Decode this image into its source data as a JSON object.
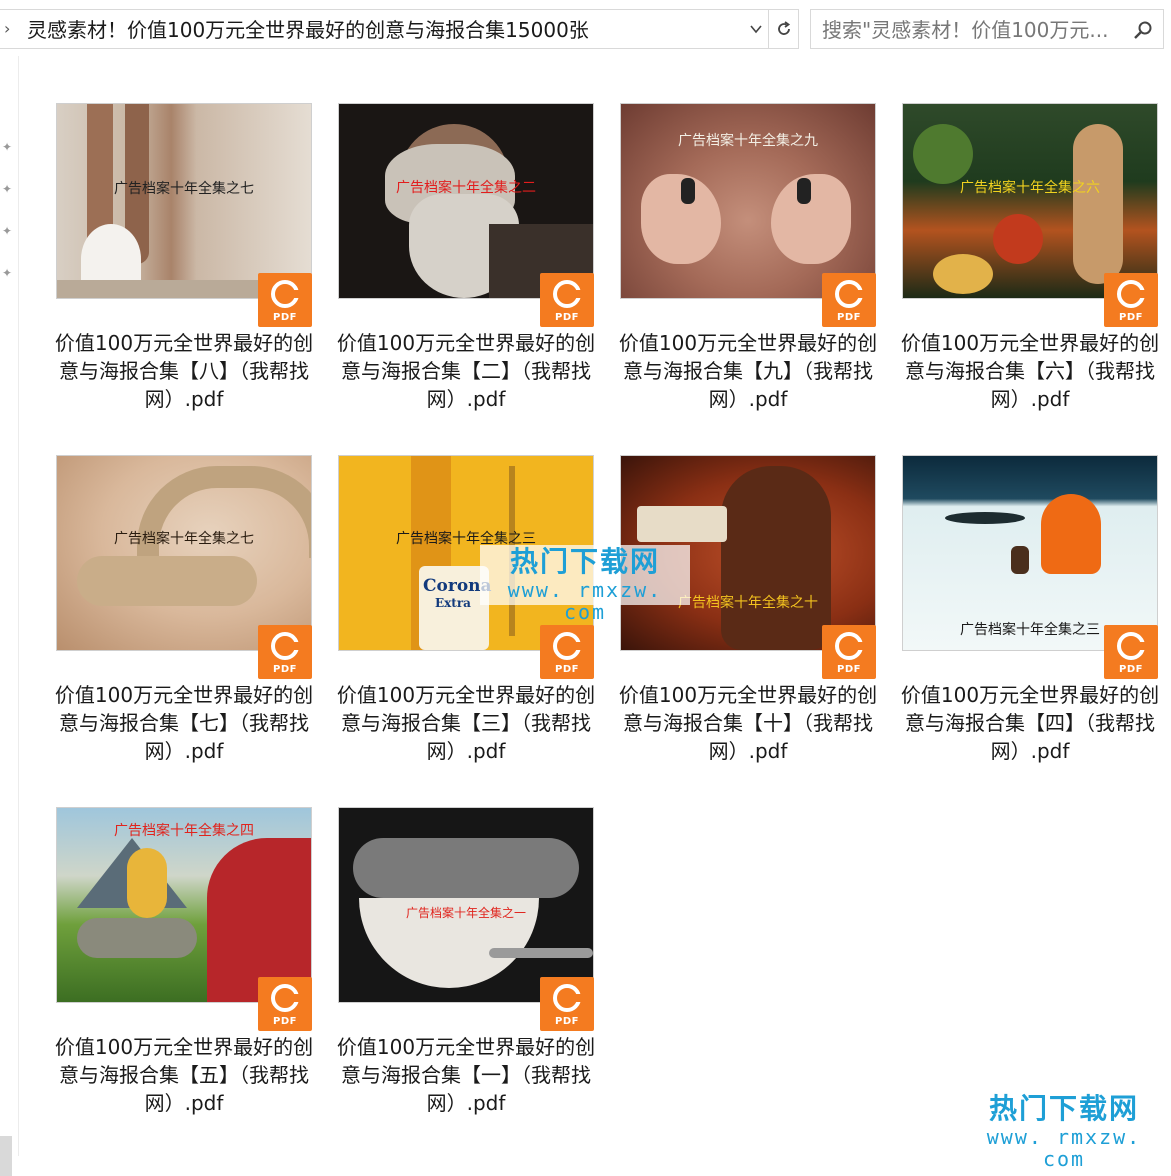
{
  "address_bar": {
    "path": "灵感素材！价值100万元全世界最好的创意与海报合集15000张"
  },
  "search": {
    "placeholder": "搜索\"灵感素材！价值100万元..."
  },
  "badge_label": "PDF",
  "files": [
    {
      "name": "价值100万元全世界最好的创意与海报合集【八】（我帮找网）.pdf",
      "thumb_caption": "广告档案十年全集之七"
    },
    {
      "name": "价值100万元全世界最好的创意与海报合集【二】（我帮找网）.pdf",
      "thumb_caption": "广告档案十年全集之二"
    },
    {
      "name": "价值100万元全世界最好的创意与海报合集【九】（我帮找网）.pdf",
      "thumb_caption": "广告档案十年全集之九"
    },
    {
      "name": "价值100万元全世界最好的创意与海报合集【六】（我帮找网）.pdf",
      "thumb_caption": "广告档案十年全集之六"
    },
    {
      "name": "价值100万元全世界最好的创意与海报合集【七】（我帮找网）.pdf",
      "thumb_caption": "广告档案十年全集之七"
    },
    {
      "name": "价值100万元全世界最好的创意与海报合集【三】（我帮找网）.pdf",
      "thumb_caption": "广告档案十年全集之三"
    },
    {
      "name": "价值100万元全世界最好的创意与海报合集【十】（我帮找网）.pdf",
      "thumb_caption": "广告档案十年全集之十"
    },
    {
      "name": "价值100万元全世界最好的创意与海报合集【四】（我帮找网）.pdf",
      "thumb_caption": "广告档案十年全集之三"
    },
    {
      "name": "价值100万元全世界最好的创意与海报合集【五】（我帮找网）.pdf",
      "thumb_caption": "广告档案十年全集之四"
    },
    {
      "name": "价值100万元全世界最好的创意与海报合集【一】（我帮找网）.pdf",
      "thumb_caption": "广告档案十年全集之一"
    }
  ],
  "watermark": {
    "title": "热门下载网",
    "url": "www. rmxzw. com"
  },
  "colors": {
    "pdf_badge": "#f47b20",
    "watermark": "#1e9fd6"
  }
}
